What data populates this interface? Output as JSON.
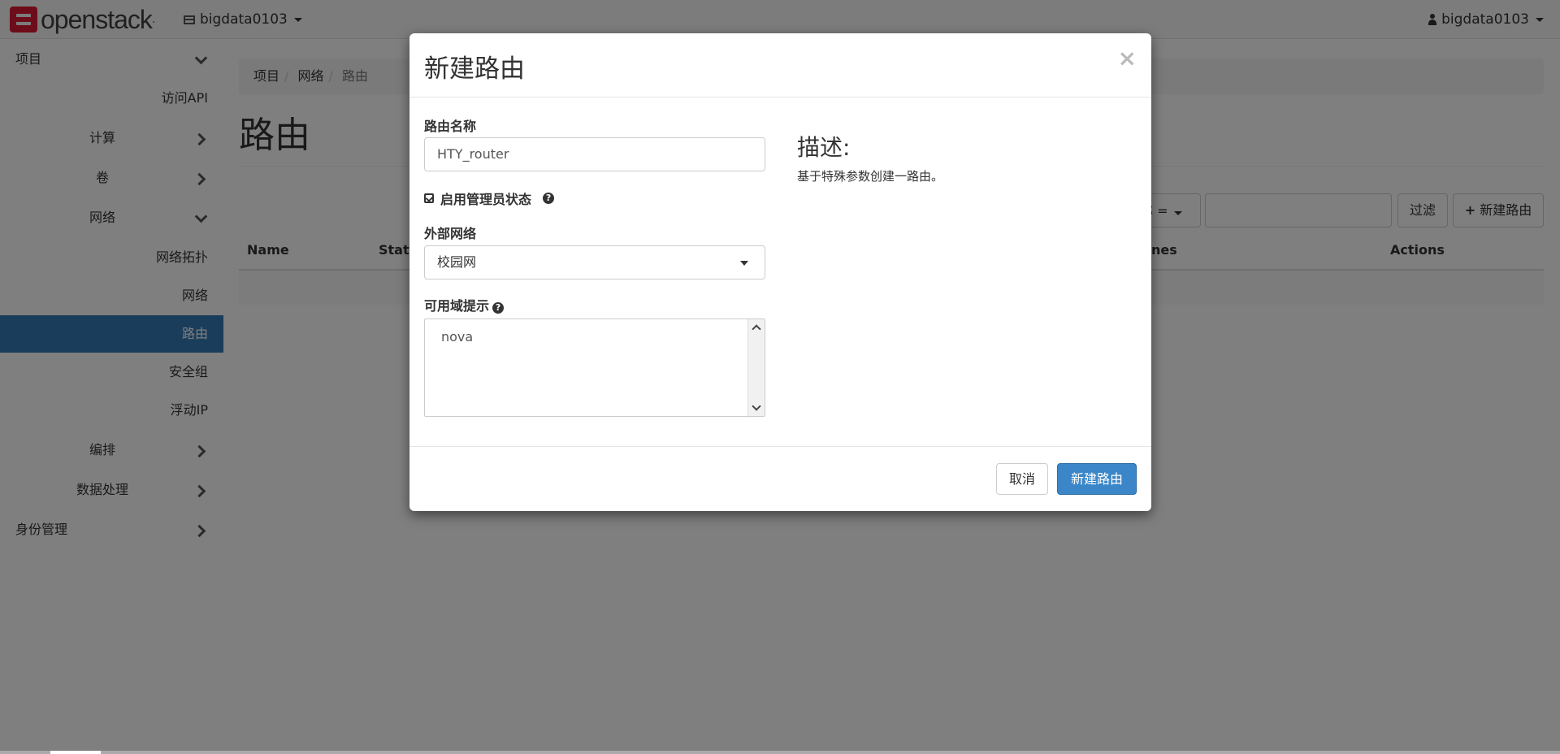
{
  "navbar": {
    "brand": "openstack",
    "project_name": "bigdata0103",
    "user_name": "bigdata0103"
  },
  "sidebar": {
    "items": [
      {
        "label": "项目"
      },
      {
        "label": "访问API"
      },
      {
        "label": "计算"
      },
      {
        "label": "卷"
      },
      {
        "label": "网络"
      },
      {
        "label": "网络拓扑"
      },
      {
        "label": "网络"
      },
      {
        "label": "路由"
      },
      {
        "label": "安全组"
      },
      {
        "label": "浮动IP"
      },
      {
        "label": "编排"
      },
      {
        "label": "数据处理"
      },
      {
        "label": "身份管理"
      }
    ]
  },
  "breadcrumb": [
    "项目",
    "网络",
    "路由"
  ],
  "page": {
    "title": "路由",
    "filter_select": "称 =",
    "filter_button": "过滤",
    "create_button": "新建路由",
    "table_headers": [
      "Name",
      "Statu",
      "ones",
      "Actions"
    ]
  },
  "modal": {
    "title": "新建路由",
    "name_label": "路由名称",
    "name_value": "HTY_router",
    "admin_state_label": "启用管理员状态",
    "external_network_label": "外部网络",
    "external_network_value": "校园网",
    "az_hint_label": "可用域提示",
    "az_options": [
      "nova"
    ],
    "description_title": "描述:",
    "description_text": "基于特殊参数创建一路由。",
    "cancel_label": "取消",
    "submit_label": "新建路由"
  },
  "colors": {
    "active_sidebar": "#337ab7",
    "primary_button": "#3a86c8",
    "brand_red": "#da1a32"
  }
}
